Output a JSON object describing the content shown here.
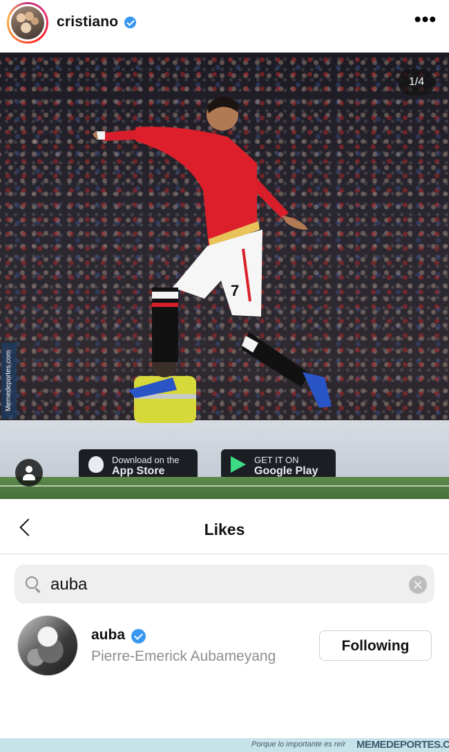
{
  "post": {
    "username": "cristiano",
    "verified": true,
    "more_icon": "more-horizontal-icon",
    "image_counter": "1/4",
    "jersey_number": "7",
    "ad_badges": [
      {
        "line1": "Download on the",
        "line2": "App Store"
      },
      {
        "line1": "GET IT ON",
        "line2": "Google Play"
      }
    ],
    "side_watermark": "Memedeportes.com",
    "tag_icon": "user-tag-icon"
  },
  "likes": {
    "title": "Likes",
    "back_icon": "chevron-left-icon",
    "search": {
      "value": "auba",
      "search_icon": "search-icon",
      "clear_icon": "clear-icon"
    },
    "results": [
      {
        "username": "auba",
        "verified": true,
        "full_name": "Pierre-Emerick Aubameyang",
        "action_label": "Following"
      }
    ]
  },
  "footer": {
    "tagline": "Porque lo importante es reír",
    "brand": "MEMEDEPORTES.COM"
  },
  "colors": {
    "verified_blue": "#3897f0",
    "secondary_text": "#8e8e8e",
    "search_bg": "#efefef",
    "footer_bg": "#c7e3ea"
  }
}
